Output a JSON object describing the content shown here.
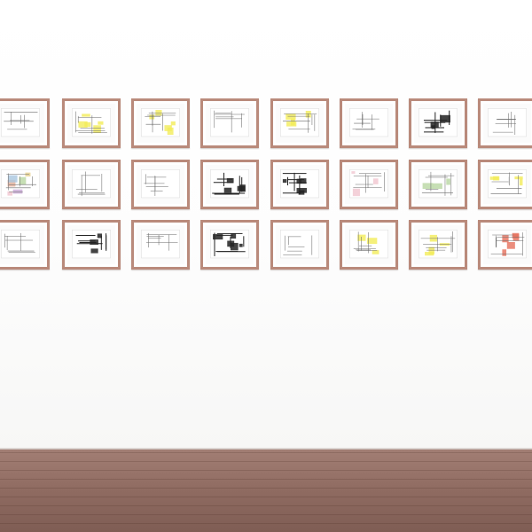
{
  "scene": {
    "wall_color": "#ffffff",
    "floor_color": "#8f6b61",
    "frame_color": "#b98a7b"
  },
  "rows": [
    [
      {
        "accent": "none"
      },
      {
        "accent": "yellow"
      },
      {
        "accent": "yellow"
      },
      {
        "accent": "none"
      },
      {
        "accent": "yellow"
      },
      {
        "accent": "none"
      },
      {
        "accent": "black"
      },
      {
        "accent": "none"
      }
    ],
    [
      {
        "accent": "multicolor"
      },
      {
        "accent": "none"
      },
      {
        "accent": "none"
      },
      {
        "accent": "black"
      },
      {
        "accent": "black"
      },
      {
        "accent": "pink"
      },
      {
        "accent": "green"
      },
      {
        "accent": "yellow"
      }
    ],
    [
      {
        "accent": "none"
      },
      {
        "accent": "black"
      },
      {
        "accent": "none"
      },
      {
        "accent": "black"
      },
      {
        "accent": "none"
      },
      {
        "accent": "yellow"
      },
      {
        "accent": "yellow"
      },
      {
        "accent": "red"
      }
    ]
  ]
}
